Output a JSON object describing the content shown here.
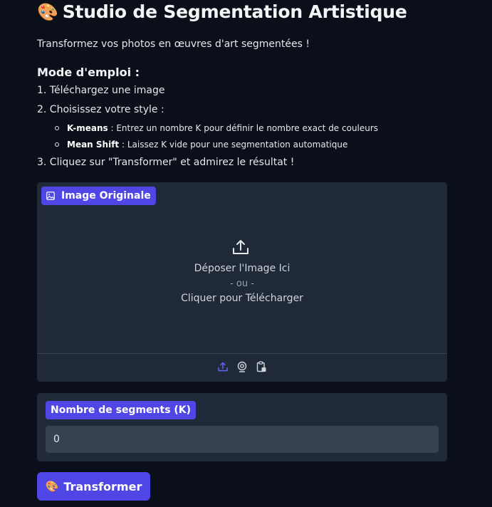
{
  "header": {
    "title_emoji": "🎨",
    "title_text": "Studio de Segmentation Artistique",
    "subtitle": "Transformez vos photos en œuvres d'art segmentées !"
  },
  "instructions": {
    "heading": "Mode d'emploi :",
    "step1": "1. Téléchargez une image",
    "step2": "2. Choisissez votre style :",
    "options": [
      {
        "name": "K-means",
        "desc": " : Entrez un nombre K pour définir le nombre exact de couleurs"
      },
      {
        "name": "Mean Shift",
        "desc": " : Laissez K vide pour une segmentation automatique"
      }
    ],
    "step3": "3. Cliquez sur \"Transformer\" et admirez le résultat !"
  },
  "image_input": {
    "label": "Image Originale",
    "drop_text": "Déposer l'Image Ici",
    "or_text": "- ou -",
    "click_text": "Cliquer pour Télécharger",
    "sources": [
      "upload-icon",
      "webcam-icon",
      "clipboard-icon"
    ],
    "active_source_color": "#6366f1"
  },
  "k_input": {
    "label": "Nombre de segments (K)",
    "value": "0"
  },
  "action": {
    "emoji": "🎨",
    "label": "Transformer"
  },
  "colors": {
    "background": "#0b0f19",
    "panel": "#1f2937",
    "accent": "#4f46e5",
    "input_bg": "#374151"
  }
}
